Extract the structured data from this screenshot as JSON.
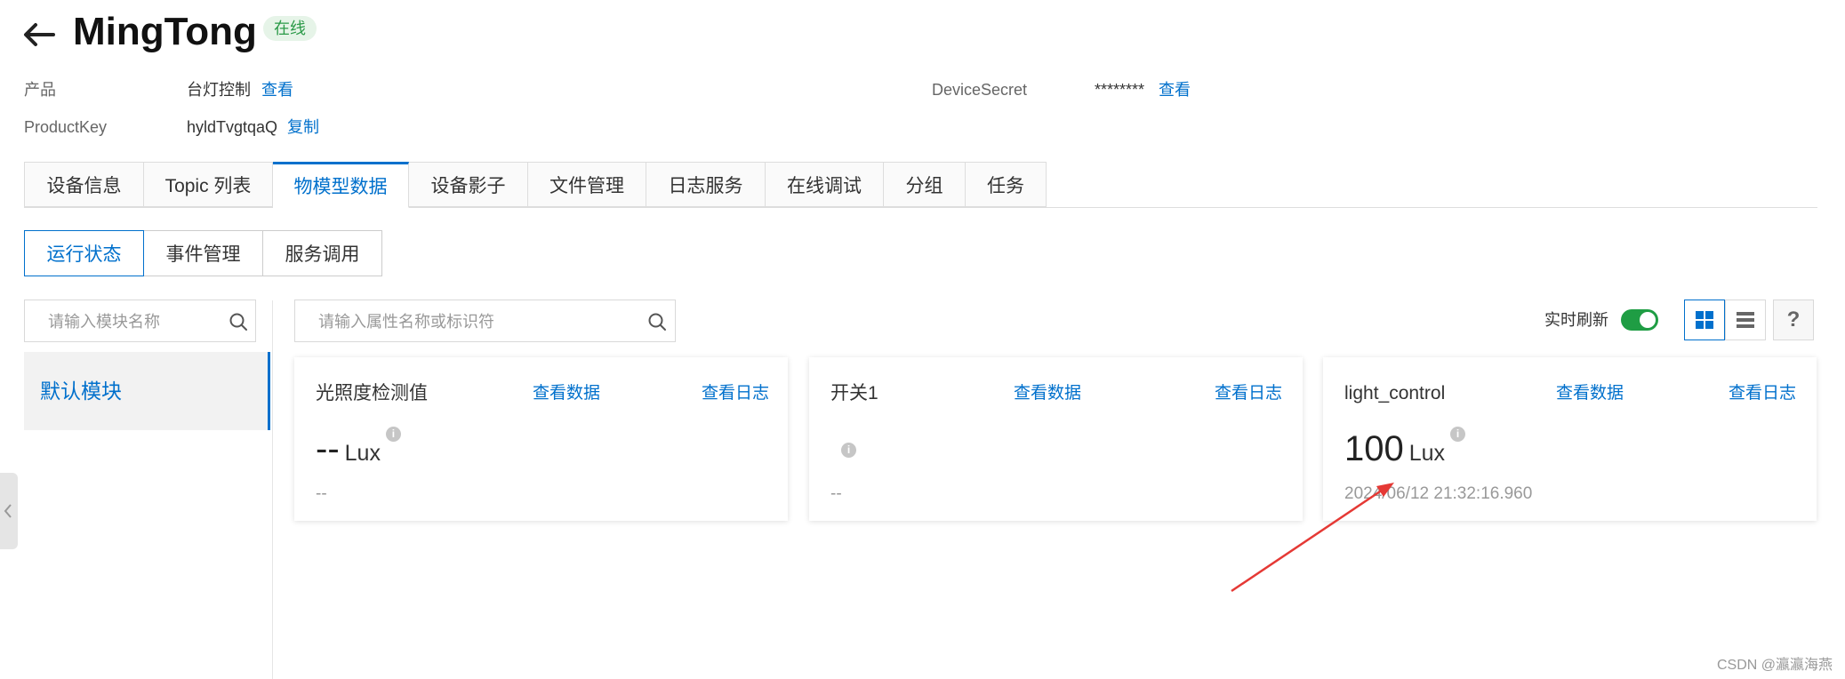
{
  "header": {
    "title": "MingTong",
    "status": "在线"
  },
  "meta": {
    "product_label": "产品",
    "product_value": "台灯控制",
    "product_link": "查看",
    "productkey_label": "ProductKey",
    "productkey_value": "hyldTvgtqaQ",
    "productkey_link": "复制",
    "secret_label": "DeviceSecret",
    "secret_value": "********",
    "secret_link": "查看"
  },
  "tabs": [
    {
      "label": "设备信息"
    },
    {
      "label": "Topic 列表"
    },
    {
      "label": "物模型数据"
    },
    {
      "label": "设备影子"
    },
    {
      "label": "文件管理"
    },
    {
      "label": "日志服务"
    },
    {
      "label": "在线调试"
    },
    {
      "label": "分组"
    },
    {
      "label": "任务"
    }
  ],
  "active_tab": "物模型数据",
  "subtabs": [
    {
      "label": "运行状态"
    },
    {
      "label": "事件管理"
    },
    {
      "label": "服务调用"
    }
  ],
  "active_subtab": "运行状态",
  "module_search": {
    "placeholder": "请输入模块名称"
  },
  "modules": [
    {
      "label": "默认模块"
    }
  ],
  "property_search": {
    "placeholder": "请输入属性名称或标识符"
  },
  "toolbar": {
    "realtime_label": "实时刷新",
    "realtime_on": true,
    "view_mode": "grid",
    "help": "?"
  },
  "cards": [
    {
      "name": "光照度检测值",
      "view_data": "查看数据",
      "view_log": "查看日志",
      "value": "--",
      "unit": "Lux",
      "time": "--"
    },
    {
      "name": "开关1",
      "view_data": "查看数据",
      "view_log": "查看日志",
      "value": "",
      "unit": "",
      "time": "--"
    },
    {
      "name": "light_control",
      "view_data": "查看数据",
      "view_log": "查看日志",
      "value": "100",
      "unit": "Lux",
      "time": "2024/06/12 21:32:16.960"
    }
  ],
  "watermark": "CSDN @瀛瀛海燕",
  "colors": {
    "accent": "#0070cc",
    "online": "#2b9a48",
    "toggle": "#1f9d44",
    "annotation_arrow": "#e53935"
  }
}
